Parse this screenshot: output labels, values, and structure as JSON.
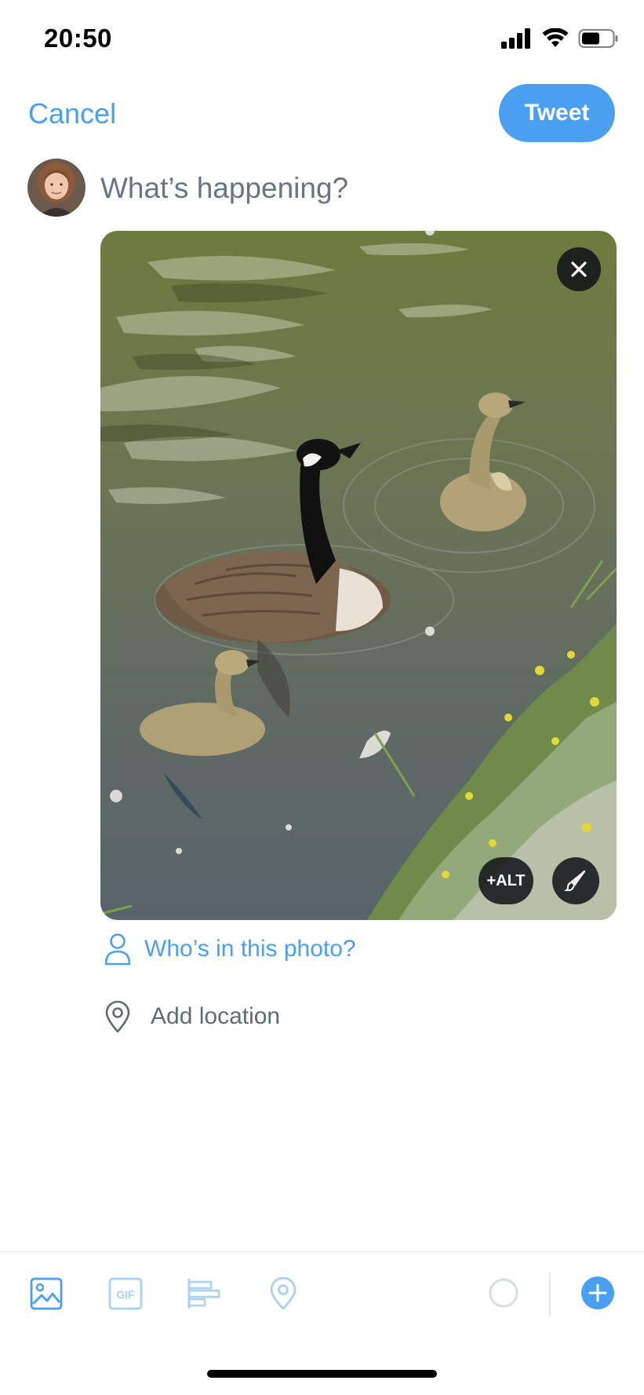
{
  "status_bar": {
    "time": "20:50"
  },
  "header": {
    "cancel_label": "Cancel",
    "tweet_label": "Tweet"
  },
  "compose": {
    "placeholder": "What’s happening?"
  },
  "photo": {
    "alt_label": "+ALT"
  },
  "tag_people": {
    "label": "Who’s in this photo?"
  },
  "location": {
    "label": "Add location"
  },
  "toolbar": {
    "items": [
      "image-icon",
      "gif-icon",
      "poll-icon",
      "location-icon",
      "char-progress-ring",
      "add-thread-button"
    ],
    "gif_text": "GIF"
  },
  "colors": {
    "accent": "#4a9ff0",
    "accent_light": "#a9d0f5",
    "muted": "#657786"
  }
}
